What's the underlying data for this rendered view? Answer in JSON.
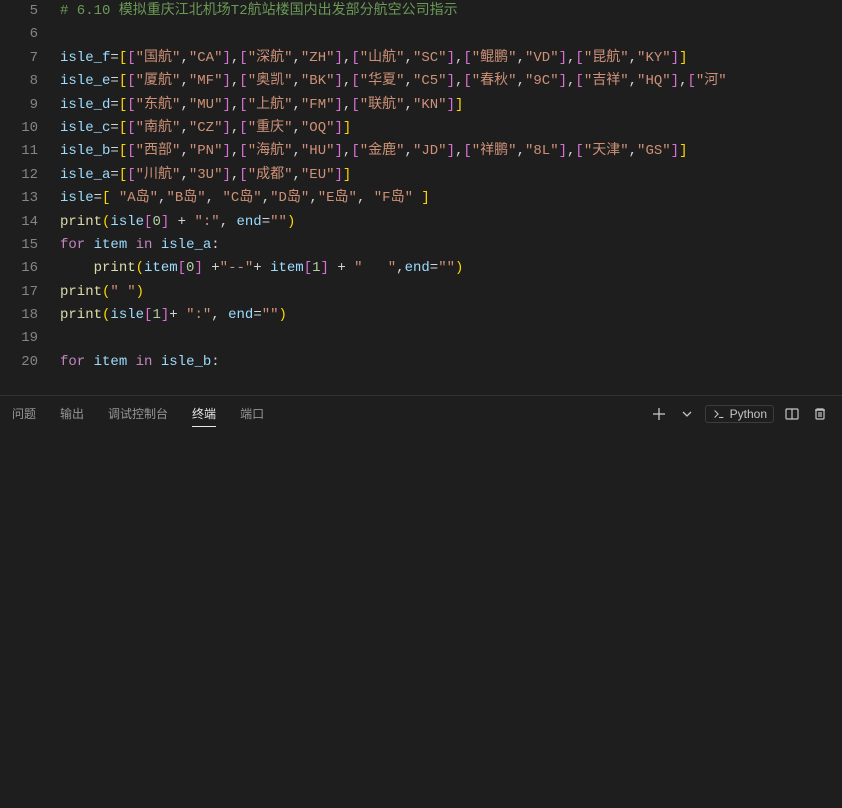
{
  "lineStart": 5,
  "lineEnd": 20,
  "code": {
    "l5_comment": "# 6.10 模拟重庆江北机场T2航站楼国内出发部分航空公司指示",
    "l7": {
      "var": "isle_f",
      "pairs": [
        [
          "国航",
          "CA"
        ],
        [
          "深航",
          "ZH"
        ],
        [
          "山航",
          "SC"
        ],
        [
          "鲲鹏",
          "VD"
        ],
        [
          "昆航",
          "KY"
        ]
      ]
    },
    "l8": {
      "var": "isle_e",
      "pairs": [
        [
          "厦航",
          "MF"
        ],
        [
          "奥凯",
          "BK"
        ],
        [
          "华夏",
          "C5"
        ],
        [
          "春秋",
          "9C"
        ],
        [
          "吉祥",
          "HQ"
        ]
      ],
      "trail": "河"
    },
    "l9": {
      "var": "isle_d",
      "pairs": [
        [
          "东航",
          "MU"
        ],
        [
          "上航",
          "FM"
        ],
        [
          "联航",
          "KN"
        ]
      ]
    },
    "l10": {
      "var": "isle_c",
      "pairs": [
        [
          "南航",
          "CZ"
        ],
        [
          "重庆",
          "OQ"
        ]
      ]
    },
    "l11": {
      "var": "isle_b",
      "pairs": [
        [
          "西部",
          "PN"
        ],
        [
          "海航",
          "HU"
        ],
        [
          "金鹿",
          "JD"
        ],
        [
          "祥鹏",
          "8L"
        ],
        [
          "天津",
          "GS"
        ]
      ]
    },
    "l12": {
      "var": "isle_a",
      "pairs": [
        [
          "川航",
          "3U"
        ],
        [
          "成都",
          "EU"
        ]
      ]
    },
    "l13": {
      "var": "isle",
      "items": [
        "A岛",
        "B岛",
        "C岛",
        "D岛",
        "E岛",
        "F岛"
      ]
    },
    "l14": {
      "fn": "print",
      "args_var": "isle",
      "idx": "0",
      "plus": "\":\"",
      "kw": "end",
      "kwv": "\"\""
    },
    "l15": {
      "for": "for",
      "item": "item",
      "in": "in",
      "iter": "isle_a"
    },
    "l16": {
      "fn": "print",
      "item": "item",
      "i0": "0",
      "sep": "\"--\"",
      "i1": "1",
      "pad": "\"   \"",
      "kw": "end",
      "kwv": "\"\""
    },
    "l17": {
      "fn": "print",
      "arg": "\" \""
    },
    "l18": {
      "fn": "print",
      "args_var": "isle",
      "idx": "1",
      "plus": "\":\"",
      "kw": "end",
      "kwv": "\"\""
    },
    "l20": {
      "for": "for",
      "item": "item",
      "in": "in",
      "iter": "isle_b"
    }
  },
  "panel": {
    "tabs": {
      "problems": "问题",
      "output": "输出",
      "debug": "调试控制台",
      "terminal": "终端",
      "ports": "端口"
    },
    "runner": "Python"
  }
}
